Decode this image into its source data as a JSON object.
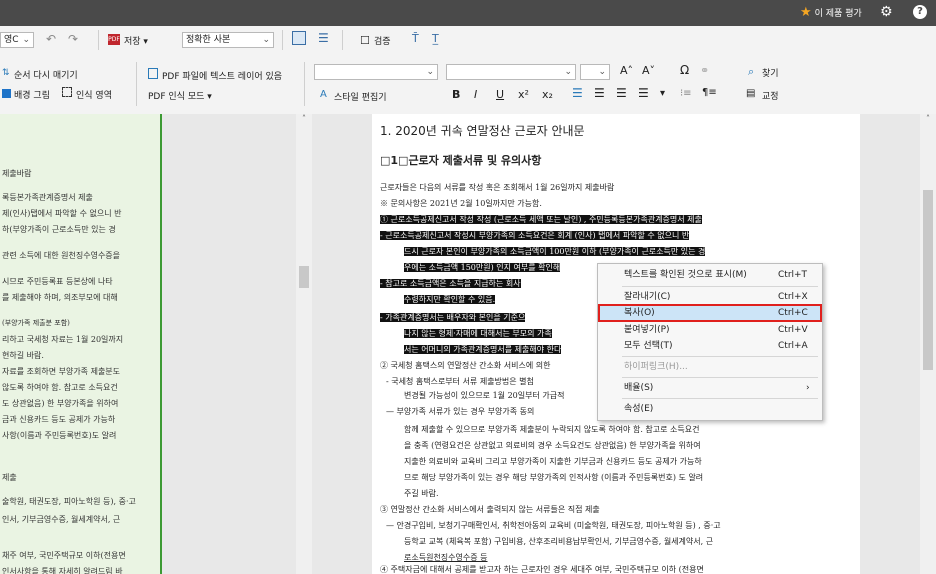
{
  "titlebar": {
    "rate_label": "이 제품 평가"
  },
  "ribbon": {
    "lang_combo": "영C",
    "save": "저장",
    "copy_combo": "정확한 사본",
    "verify": "검증",
    "reorder": "순서 다시 매기기",
    "pdf_text_layer": "PDF 파일에 텍스트 레이어 있음",
    "bg_image": "배경 그림",
    "recog_area": "인식 영역",
    "pdf_mode": "PDF 인식 모드",
    "style_editor": "스타일 편집기",
    "find": "찾기",
    "proof": "교정",
    "fmt_bold": "B",
    "fmt_italic": "I",
    "fmt_underline": "U",
    "fmt_sup": "x²",
    "fmt_sub": "x₂"
  },
  "left_lines": [
    "제출바람",
    "록등본가족관계증명서 제출",
    "제(인사)탭에서 파악할 수 없으니 반",
    "하(부양가족이 근로소득만 있는 경",
    "관련 소득에 대한 원천징수영수증을",
    "시므로 주민등록표 등본상에 나타",
    "를 제출해야 하며, 의조부모에 대해",
    "(부양가족 제출분 포함)",
    "리하고 국세청 자료는 1월 20일까지",
    "현하길 바람.",
    "자료를 조회하면 부양가족 제출분도",
    "않도록 하여야 함. 참고로 소득요건",
    "도 상관없음) 한 부양가족을 위하여",
    "금과 신용카드 등도 공제가 가능하",
    "사항(이름과 주민등록번호)도 알려",
    "제출",
    "술학원, 태권도장, 피아노학원 등), 중·고",
    "인서, 기부금영수증, 월세계약서, 근",
    "채주 여부, 국민주택규모 이하(전용면",
    "인서사항을 통해 자세히 알려드림 바"
  ],
  "doc": {
    "title": "1. 2020년 귀속 연말정산 근로자 안내문",
    "heading": "□1□근로자 제출서류 및 유의사항",
    "lines": [
      "근로자들은 다음의 서류를 작성 혹은 조회해서 1월 26일까지 제출바람",
      "※ 문의사항은 2021년 2월 10일까지만 가능함.",
      "① 근로소득공제신고서 작성 작성 (근로소득 세액 또는 날인) , 주민등록등본가족관계증명서 제출",
      "- 근로소득공제신고서 작성시 부양가족의 소득요건은 회계 (인사) 탭에서 파악할 수 없으니 반",
      "드시 근로자 본인이 부양가족의 소득금액이 100만원 이하 (부양가족이 근로소득만 있는 경",
      "우에는 소득금액 150만원) 인지 여부를 확인해",
      "- 참고로 소득금액은 소득을 지급하는 회사",
      "수령하지만 확인할 수 있음.",
      "- 가족관계증명서는 배우자와 본인을 기준으",
      "나지 않는 형제·자매에 대해서는 부모의 가족",
      "서는 어머니의 가족관계증명서를 제출해야 한다",
      "② 국세청 홈택스의 연말정산 간소화 서비스에 의한",
      "- 국세청 홈택스로부터 서류 제출방법은 별첨",
      "변경될 가능성이 있으므로 1월 20일부터 가급적",
      "— 부양가족 서류가 있는 경우 부양가족 동의",
      "함께 제출할 수 있으므로 부양가족 제출분이 누락되지 않도록 하여야 함. 참고로 소득요건",
      "을 충족 (연령요건은 상관없고 의료비의 경우 소득요건도 상관없음) 한 부양가족을 위하여",
      "지출한 의료비와 교육비 그리고 부양가족이 지출한 기부금과 신용카드 등도 공제가 가능하",
      "므로 해당 부양가족이 있는 경우 해당 부양가족의 인적사항 (이름과 주민등록번호) 도 알려",
      "주길 바람.",
      "③ 연말정산 간소화 서비스에서 출력되지 않는 서류들은 직접 제출",
      "— 안경구입비, 보청기구매확인서, 취학전아동의 교육비 (미술학원, 태권도장, 피아노학원 등) , 중·고",
      "등학교 교복 (체육복 포함) 구입비용, 산후조리비용납부확인서, 기부금영수증, 월세계약서, 근",
      "로소득원천징수영수증 등",
      "④ 주택자금에 대해서 공제를 받고자 하는 근로자인 경우 세대주 여부, 국민주택규모 이하 (전용면"
    ]
  },
  "context_menu": {
    "items": [
      {
        "label": "텍스트를 확인된 것으로 표시(M)",
        "shortcut": "Ctrl+T"
      },
      {
        "label": "잘라내기(C)",
        "shortcut": "Ctrl+X"
      },
      {
        "label": "복사(O)",
        "shortcut": "Ctrl+C"
      },
      {
        "label": "붙여넣기(P)",
        "shortcut": "Ctrl+V"
      },
      {
        "label": "모두 선택(T)",
        "shortcut": "Ctrl+A"
      },
      {
        "label": "하이퍼링크(H)...",
        "shortcut": ""
      },
      {
        "label": "배율(S)",
        "shortcut": "›"
      },
      {
        "label": "속성(E)",
        "shortcut": ""
      }
    ]
  },
  "colors": {
    "accent_green": "#3c9a33",
    "highlight_red": "#e0201d",
    "menu_selected": "#cce4f7"
  }
}
